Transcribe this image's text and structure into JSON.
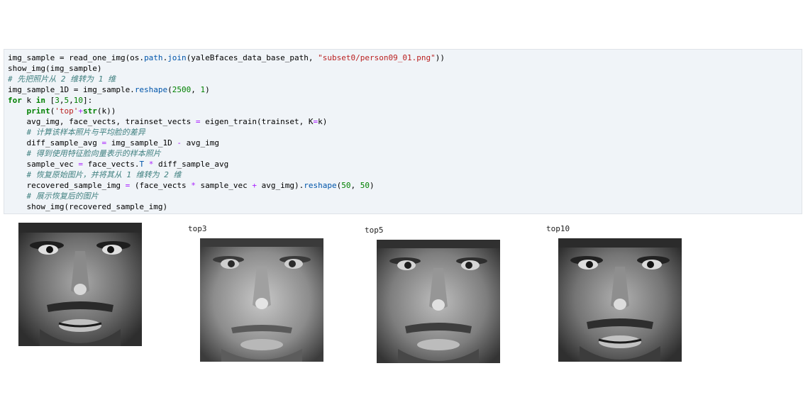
{
  "cell": {
    "lines": [
      [
        {
          "t": "img_sample = read_one_img(os.",
          "c": ""
        },
        {
          "t": "path",
          "c": "attr"
        },
        {
          "t": ".",
          "c": ""
        },
        {
          "t": "join",
          "c": "attr"
        },
        {
          "t": "(yaleBfaces_data_base_path, ",
          "c": ""
        },
        {
          "t": "\"subset0/person09_01.png\"",
          "c": "str"
        },
        {
          "t": "))",
          "c": ""
        }
      ],
      [
        {
          "t": "show_img(img_sample)",
          "c": ""
        }
      ],
      [
        {
          "t": "# 先把照片从 2 维转为 1 维",
          "c": "cm"
        }
      ],
      [
        {
          "t": "img_sample_1D = img_sample.",
          "c": ""
        },
        {
          "t": "reshape",
          "c": "attr"
        },
        {
          "t": "(",
          "c": ""
        },
        {
          "t": "2500",
          "c": "num"
        },
        {
          "t": ", ",
          "c": ""
        },
        {
          "t": "1",
          "c": "num"
        },
        {
          "t": ")",
          "c": ""
        }
      ],
      [
        {
          "t": "for",
          "c": "kw"
        },
        {
          "t": " k ",
          "c": ""
        },
        {
          "t": "in",
          "c": "kw"
        },
        {
          "t": " [",
          "c": ""
        },
        {
          "t": "3",
          "c": "num"
        },
        {
          "t": ",",
          "c": ""
        },
        {
          "t": "5",
          "c": "num"
        },
        {
          "t": ",",
          "c": ""
        },
        {
          "t": "10",
          "c": "num"
        },
        {
          "t": "]:",
          "c": ""
        }
      ],
      [
        {
          "t": "    ",
          "c": ""
        },
        {
          "t": "print",
          "c": "kw"
        },
        {
          "t": "(",
          "c": ""
        },
        {
          "t": "'top'",
          "c": "str"
        },
        {
          "t": "+",
          "c": "op"
        },
        {
          "t": "str",
          "c": "kw"
        },
        {
          "t": "(k))",
          "c": ""
        }
      ],
      [
        {
          "t": "    avg_img, face_vects, trainset_vects ",
          "c": ""
        },
        {
          "t": "=",
          "c": "op"
        },
        {
          "t": " eigen_train(trainset, K",
          "c": ""
        },
        {
          "t": "=",
          "c": "op"
        },
        {
          "t": "k)",
          "c": ""
        }
      ],
      [
        {
          "t": "    ",
          "c": ""
        },
        {
          "t": "# 计算该样本照片与平均脸的差异",
          "c": "cm"
        }
      ],
      [
        {
          "t": "    diff_sample_avg ",
          "c": ""
        },
        {
          "t": "=",
          "c": "op"
        },
        {
          "t": " img_sample_1D ",
          "c": ""
        },
        {
          "t": "-",
          "c": "op"
        },
        {
          "t": " avg_img",
          "c": ""
        }
      ],
      [
        {
          "t": "    ",
          "c": ""
        },
        {
          "t": "# 得到使用特征脸向量表示的样本照片",
          "c": "cm"
        }
      ],
      [
        {
          "t": "    sample_vec ",
          "c": ""
        },
        {
          "t": "=",
          "c": "op"
        },
        {
          "t": " face_vects.",
          "c": ""
        },
        {
          "t": "T",
          "c": "attr"
        },
        {
          "t": " ",
          "c": ""
        },
        {
          "t": "*",
          "c": "op"
        },
        {
          "t": " diff_sample_avg",
          "c": ""
        }
      ],
      [
        {
          "t": "    ",
          "c": ""
        },
        {
          "t": "# 恢复原始图片，并将其从 1 维转为 2 维",
          "c": "cm"
        }
      ],
      [
        {
          "t": "    recovered_sample_img ",
          "c": ""
        },
        {
          "t": "=",
          "c": "op"
        },
        {
          "t": " (face_vects ",
          "c": ""
        },
        {
          "t": "*",
          "c": "op"
        },
        {
          "t": " sample_vec ",
          "c": ""
        },
        {
          "t": "+",
          "c": "op"
        },
        {
          "t": " avg_img).",
          "c": ""
        },
        {
          "t": "reshape",
          "c": "attr"
        },
        {
          "t": "(",
          "c": ""
        },
        {
          "t": "50",
          "c": "num"
        },
        {
          "t": ", ",
          "c": ""
        },
        {
          "t": "50",
          "c": "num"
        },
        {
          "t": ")",
          "c": ""
        }
      ],
      [
        {
          "t": "    ",
          "c": ""
        },
        {
          "t": "# 展示恢复后的图片",
          "c": "cm"
        }
      ],
      [
        {
          "t": "    show_img(recovered_sample_img)",
          "c": ""
        }
      ]
    ]
  },
  "outputs": {
    "label_top3": "top3",
    "label_top5": "top5",
    "label_top10": "top10"
  },
  "colors": {
    "cell_bg": "#f0f4f8",
    "keyword": "#008000",
    "string": "#ba2121",
    "comment": "#408080"
  }
}
